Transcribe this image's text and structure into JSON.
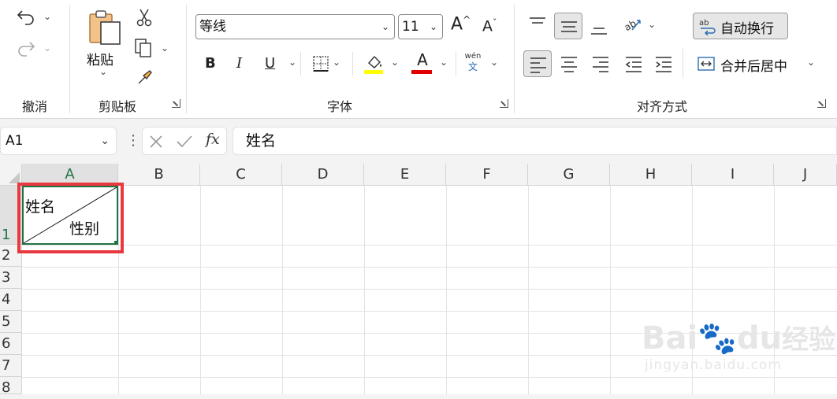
{
  "ribbon": {
    "undo_group": {
      "label": "撤消"
    },
    "clipboard_group": {
      "label": "剪贴板",
      "paste_label": "粘贴"
    },
    "font_group": {
      "label": "字体",
      "font_name": "等线",
      "font_size": "11",
      "bold": "B",
      "italic": "I",
      "underline": "U",
      "grow": "A",
      "shrink": "A",
      "font_color_letter": "A",
      "fill_color": "#ffff00",
      "font_color": "#e00000",
      "phonetic_top": "wén",
      "phonetic_bottom": "文"
    },
    "align_group": {
      "label": "对齐方式",
      "wrap_text": "自动换行",
      "merge_center": "合并后居中",
      "wrap_icon_text": "ab"
    }
  },
  "formula_bar": {
    "name_box": "A1",
    "fx": "fx",
    "content": "姓名"
  },
  "sheet": {
    "columns": [
      "A",
      "B",
      "C",
      "D",
      "E",
      "F",
      "G",
      "H",
      "I",
      "J"
    ],
    "rows": [
      "1",
      "2",
      "3",
      "4",
      "5",
      "6",
      "7",
      "8"
    ],
    "selected_column": "A",
    "selected_row": "1",
    "cell_a1": {
      "top_left": "姓名",
      "bottom_right": "性别"
    }
  },
  "watermark": {
    "brand": "Bai",
    "brand2": "du",
    "suffix": "经验",
    "url": "jingyan.baidu.com"
  },
  "colors": {
    "accent_green": "#217346",
    "highlight_red": "#e8393f"
  }
}
